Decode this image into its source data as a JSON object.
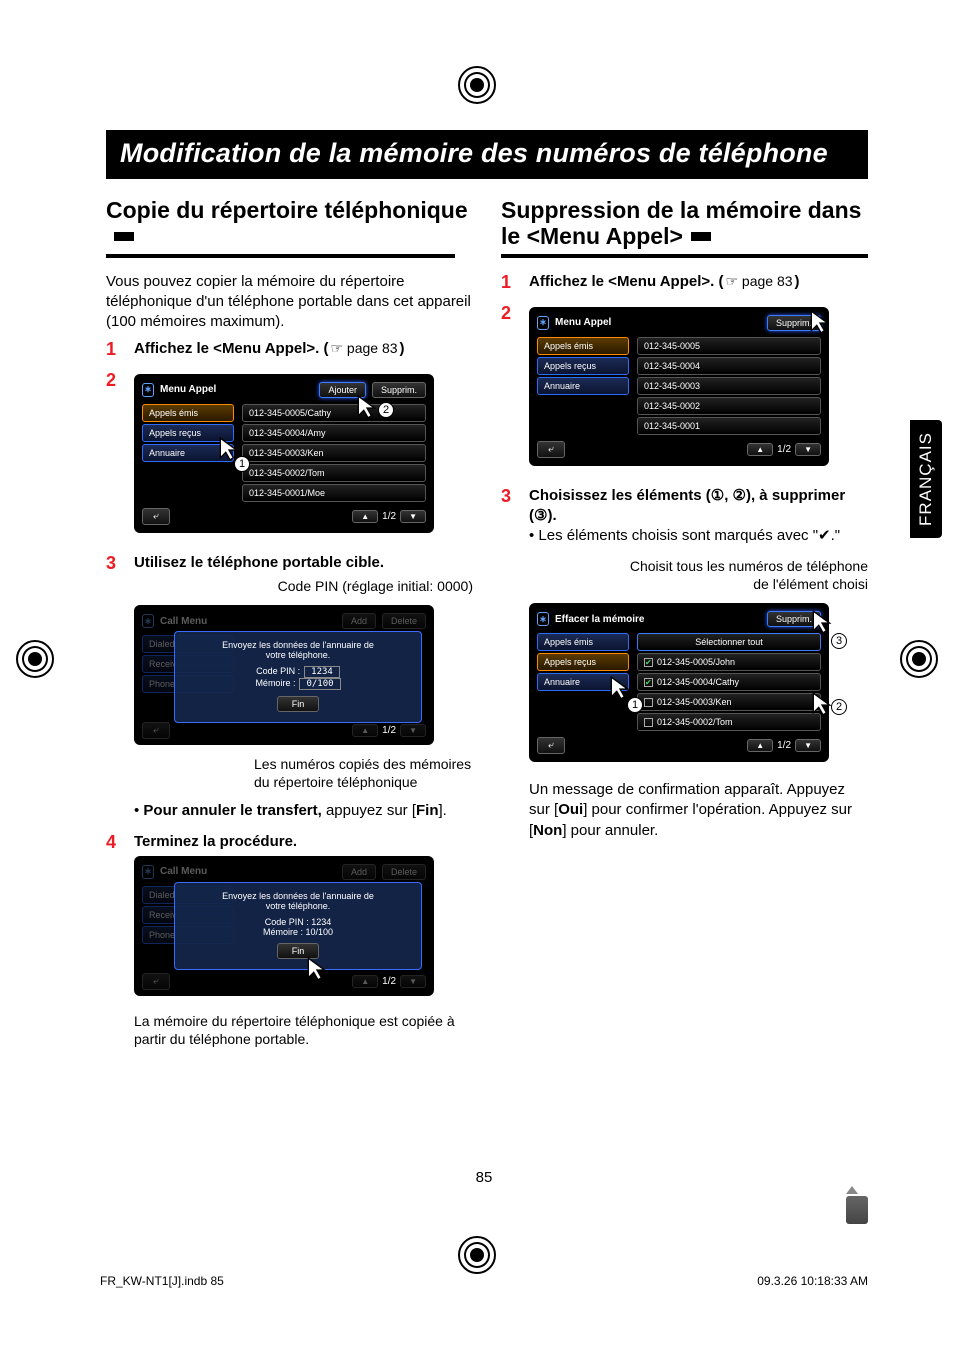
{
  "page": {
    "banner_title": "Modification de la mémoire des numéros de téléphone",
    "side_tab": "FRANÇAIS",
    "page_number": "85",
    "footer_left": "FR_KW-NT1[J].indb   85",
    "footer_right": "09.3.26   10:18:33 AM"
  },
  "left": {
    "heading": "Copie du répertoire téléphonique",
    "intro": "Vous pouvez copier la mémoire du répertoire téléphonique d'un téléphone portable dans cet appareil (100 mémoires maximum).",
    "steps": {
      "s1_label": "1",
      "s1_text_pre": "Affichez le <Menu Appel>. (",
      "s1_pageref": "☞ page 83",
      "s1_text_post": ")",
      "s2_label": "2",
      "s3_label": "3",
      "s3_text": "Utilisez le téléphone portable cible.",
      "s3_caption_top": "Code PIN (réglage initial: 0000)",
      "s3_caption_bottom": "Les numéros copiés des mémoires du répertoire téléphonique",
      "s3_note_pre": "Pour annuler le transfert,",
      "s3_note_post": " appuyez sur [",
      "s3_note_bold": "Fin",
      "s3_note_end": "].",
      "s4_label": "4",
      "s4_text": "Terminez la procédure.",
      "s4_caption": "La mémoire du répertoire téléphonique est copiée à partir du téléphone portable."
    },
    "screenshot1": {
      "menu_title": "Menu Appel",
      "btn_add": "Ajouter",
      "btn_del": "Supprim.",
      "left_items": [
        "Appels émis",
        "Appels reçus",
        "Annuaire"
      ],
      "right_items": [
        "012-345-0005/Cathy",
        "012-345-0004/Amy",
        "012-345-0003/Ken",
        "012-345-0002/Tom",
        "012-345-0001/Moe"
      ],
      "back": "⤶",
      "pager": "1/2",
      "circ1": "1",
      "circ2": "2"
    },
    "screenshot2": {
      "menu_title": "Call Menu",
      "btn_add": "Add",
      "btn_del": "Delete",
      "left_items": [
        "Dialed",
        "Receiv",
        "Phone"
      ],
      "modal_line1": "Envoyez les données de l'annuaire de",
      "modal_line2": "votre téléphone.",
      "pin_label": "Code PIN :",
      "pin_value": "1234",
      "mem_label": "Mémoire :",
      "mem_value": "0/100",
      "md_btn": "Fin",
      "back": "⤶"
    },
    "screenshot3": {
      "menu_title": "Call Menu",
      "btn_add": "Add",
      "btn_del": "Delete",
      "left_items": [
        "Dialed",
        "Receiv",
        "Phone"
      ],
      "modal_line1": "Envoyez les données de l'annuaire de",
      "modal_line2": "votre téléphone.",
      "pin_label": "Code PIN  :  1234",
      "mem_label": "Mémoire  :  10/100",
      "md_btn": "Fin",
      "back": "⤶"
    }
  },
  "right": {
    "heading": "Suppression de la mémoire dans le <Menu Appel>",
    "steps": {
      "s1_label": "1",
      "s1_text_pre": "Affichez le <Menu Appel>. (",
      "s1_pageref": "☞ page 83",
      "s1_text_post": ")",
      "s2_label": "2",
      "s3_label": "3",
      "s3_text_pre": "Choisissez les éléments (①, ②), à supprimer (③).",
      "s3_note": "Les éléments choisis sont marqués avec \"✔.\"",
      "s3_caption": "Choisit tous les numéros de téléphone de l'élément choisi",
      "finish_p1": "Un message de confirmation apparaît. Appuyez sur [",
      "finish_b1": "Oui",
      "finish_p2": "] pour confirmer l'opération. Appuyez sur [",
      "finish_b2": "Non",
      "finish_p3": "] pour annuler."
    },
    "screenshotA": {
      "menu_title": "Menu Appel",
      "btn_del": "Supprim.",
      "left_items": [
        "Appels émis",
        "Appels reçus",
        "Annuaire"
      ],
      "right_items": [
        "012-345-0005",
        "012-345-0004",
        "012-345-0003",
        "012-345-0002",
        "012-345-0001"
      ],
      "back": "⤶",
      "pager": "1/2"
    },
    "screenshotB": {
      "menu_title": "Effacer la mémoire",
      "btn_del": "Supprim.",
      "sel_all": "Sélectionner tout",
      "left_items": [
        "Appels émis",
        "Appels reçus",
        "Annuaire"
      ],
      "right_items": [
        "012-345-0005/John",
        "012-345-0004/Cathy",
        "012-345-0003/Ken",
        "012-345-0002/Tom"
      ],
      "checks": [
        true,
        true,
        false,
        false
      ],
      "back": "⤶",
      "pager": "1/2",
      "circ1": "1",
      "circ2": "2",
      "circ3": "3"
    }
  }
}
